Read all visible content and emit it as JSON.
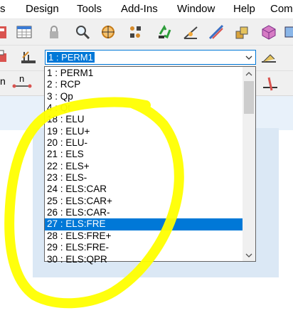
{
  "menu": [
    "s",
    "Design",
    "Tools",
    "Add-Ins",
    "Window",
    "Help",
    "Com"
  ],
  "combo": {
    "selected": "1 : PERM1"
  },
  "load_cases": [
    "1 : PERM1",
    "2 : RCP",
    "3 : Qp",
    "4 : Qt",
    "18 : ELU",
    "19 : ELU+",
    "20 : ELU-",
    "21 : ELS",
    "22 : ELS+",
    "23 : ELS-",
    "24 : ELS:CAR",
    "25 : ELS:CAR+",
    "26 : ELS:CAR-",
    "27 : ELS:FRE",
    "28 : ELS:FRE+",
    "29 : ELS:FRE-",
    "30 : ELS:QPR"
  ],
  "highlighted_index": 13,
  "toolbar_row3_label": "n",
  "icons": [
    "calculator-icon",
    "table-icon",
    "lock-icon",
    "zoom-icon",
    "target-icon",
    "move-icon",
    "recycle-icon",
    "measure-icon",
    "beam-icon",
    "layers-icon",
    "cube-icon",
    "structure-icon"
  ],
  "colors": {
    "highlight": "#0078d7",
    "annotation": "#ffff00",
    "panel": "#dbe8f5"
  }
}
